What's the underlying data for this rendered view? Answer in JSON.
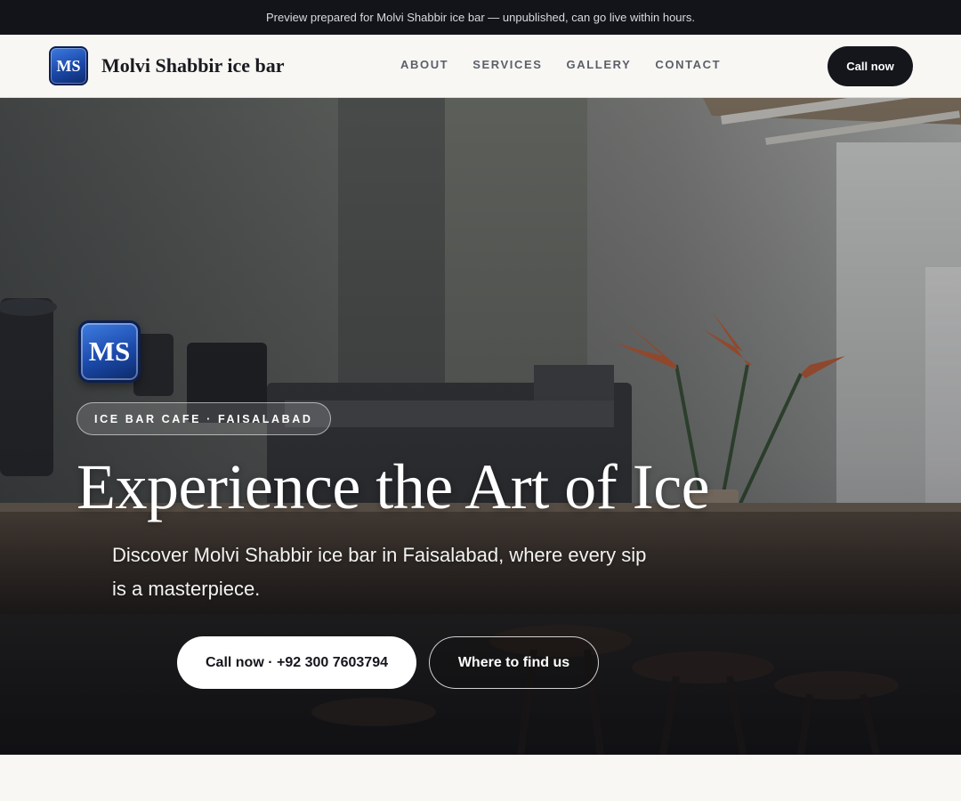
{
  "preview_bar": {
    "text": "Preview prepared for Molvi Shabbir ice bar — unpublished, can go live within hours."
  },
  "navbar": {
    "logo_initials": "MS",
    "brand_name": "Molvi Shabbir ice bar",
    "links": [
      "ABOUT",
      "SERVICES",
      "GALLERY",
      "CONTACT"
    ],
    "cta_label": "Call now"
  },
  "hero": {
    "logo_initials": "MS",
    "tagline": "ICE BAR CAFE · FAISALABAD",
    "title": "Experience the Art of Ice",
    "subtitle": "Discover Molvi Shabbir ice bar in Faisalabad, where every sip is a masterpiece.",
    "primary_button": "Call now · +92 300 7603794",
    "secondary_button": "Where to find us",
    "background_image": "cafe-interior-espresso-bar-with-bird-of-paradise-flowers"
  },
  "colors": {
    "preview_bar_bg": "#12141a",
    "nav_bg": "#f8f7f4",
    "cta_dark": "#14161c",
    "logo_blue": "#1a48a8"
  }
}
